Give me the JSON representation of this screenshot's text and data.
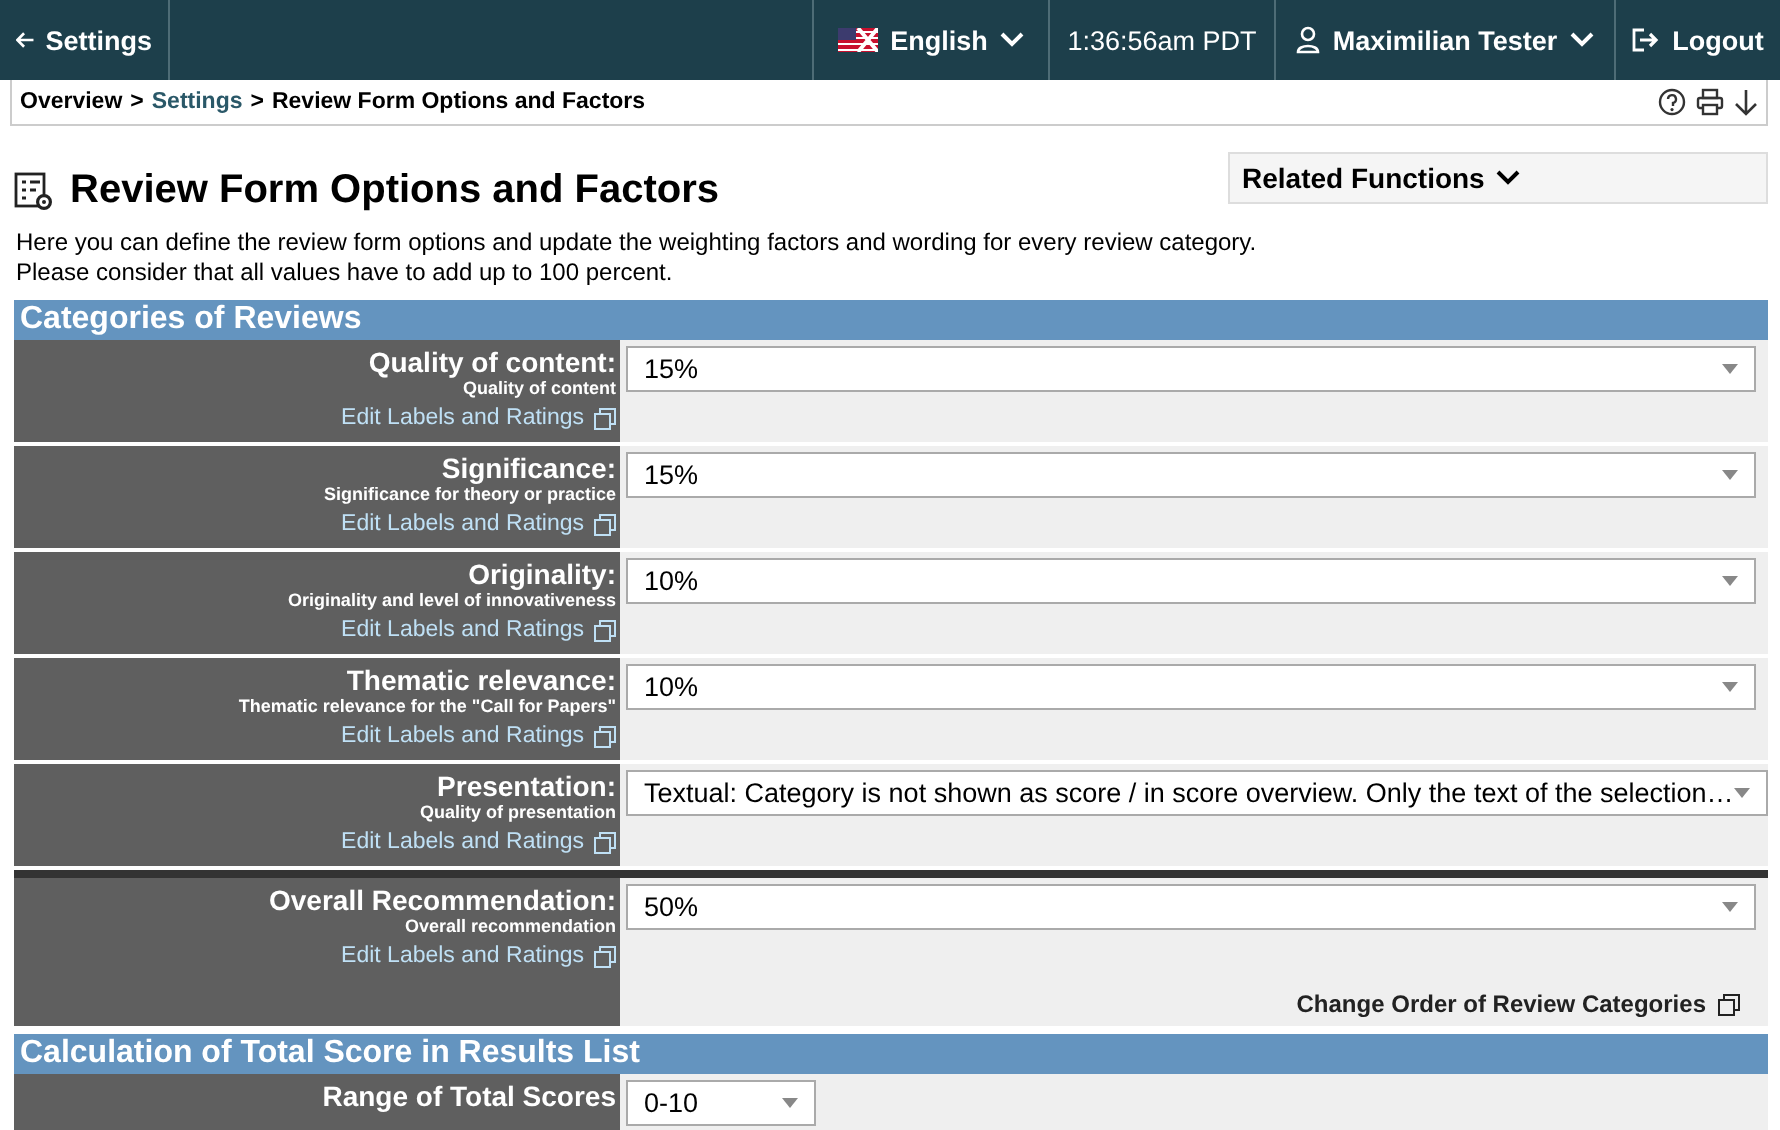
{
  "top_bar": {
    "back": "Settings",
    "language": "English",
    "time": "1:36:56am PDT",
    "user": "Maximilian Tester",
    "logout": "Logout"
  },
  "breadcrumb": {
    "separator": ">",
    "items": [
      {
        "label": "Overview",
        "kind": "plain"
      },
      {
        "label": "Settings",
        "kind": "link"
      },
      {
        "label": "Review Form Options and Factors",
        "kind": "plain"
      }
    ]
  },
  "page": {
    "title": "Review Form Options and Factors",
    "related_functions": "Related Functions",
    "intro": [
      "Here you can define the review form options and update the weighting factors and wording for every review category.",
      "Please consider that all values have to add up to 100 percent."
    ]
  },
  "categories_section": {
    "title": "Categories of Reviews",
    "rows": [
      {
        "label": "Quality of content:",
        "description": "Quality of content",
        "edit_link": "Edit Labels and Ratings",
        "value": "15%"
      },
      {
        "label": "Significance:",
        "description": "Significance for theory or practice",
        "edit_link": "Edit Labels and Ratings",
        "value": "15%"
      },
      {
        "label": "Originality:",
        "description": "Originality and level of innovativeness",
        "edit_link": "Edit Labels and Ratings",
        "value": "10%"
      },
      {
        "label": "Thematic relevance:",
        "description": "Thematic relevance for the \"Call for Papers\"",
        "edit_link": "Edit Labels and Ratings",
        "value": "10%"
      },
      {
        "label": "Presentation:",
        "description": "Quality of presentation",
        "edit_link": "Edit Labels and Ratings",
        "value": "Textual: Category is not shown as score / in score overview. Only the text of the selection…"
      }
    ],
    "overall": {
      "label": "Overall Recommendation:",
      "description": "Overall recommendation",
      "edit_link": "Edit Labels and Ratings",
      "value": "50%"
    },
    "change_order": "Change Order of Review Categories"
  },
  "score_section": {
    "title": "Calculation of Total Score in Results List",
    "rows": [
      {
        "label": "Range of Total Scores",
        "value": "0-10"
      }
    ]
  }
}
